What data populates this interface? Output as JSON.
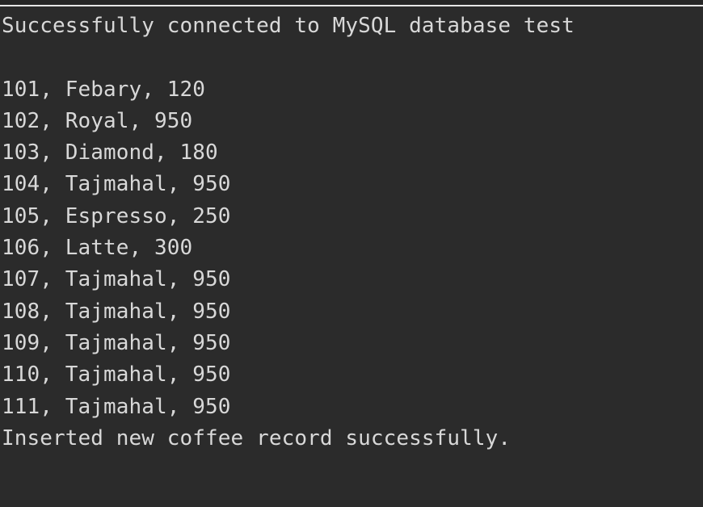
{
  "console": {
    "top_clipped_text": "",
    "lines": [
      "Successfully connected to MySQL database test",
      "",
      "101, Febary, 120",
      "102, Royal, 950",
      "103, Diamond, 180",
      "104, Tajmahal, 950",
      "105, Espresso, 250",
      "106, Latte, 300",
      "107, Tajmahal, 950",
      "108, Tajmahal, 950",
      "109, Tajmahal, 950",
      "110, Tajmahal, 950",
      "111, Tajmahal, 950",
      "Inserted new coffee record successfully."
    ]
  },
  "colors": {
    "background": "#2b2b2b",
    "text": "#d8d8d8",
    "top_border": "#e7e7e7"
  }
}
